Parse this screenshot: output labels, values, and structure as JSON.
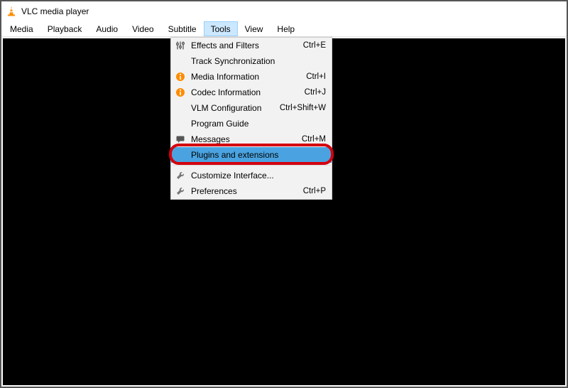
{
  "titlebar": {
    "title": "VLC media player"
  },
  "menubar": {
    "items": [
      {
        "label": "Media"
      },
      {
        "label": "Playback"
      },
      {
        "label": "Audio"
      },
      {
        "label": "Video"
      },
      {
        "label": "Subtitle"
      },
      {
        "label": "Tools"
      },
      {
        "label": "View"
      },
      {
        "label": "Help"
      }
    ],
    "open_index": 5
  },
  "tools_menu": {
    "items": [
      {
        "icon": "sliders-icon",
        "label": "Effects and Filters",
        "shortcut": "Ctrl+E"
      },
      {
        "icon": "",
        "label": "Track Synchronization",
        "shortcut": ""
      },
      {
        "icon": "info-orange-icon",
        "label": "Media Information",
        "shortcut": "Ctrl+I"
      },
      {
        "icon": "info-orange-icon",
        "label": "Codec Information",
        "shortcut": "Ctrl+J"
      },
      {
        "icon": "",
        "label": "VLM Configuration",
        "shortcut": "Ctrl+Shift+W"
      },
      {
        "icon": "",
        "label": "Program Guide",
        "shortcut": ""
      },
      {
        "icon": "message-icon",
        "label": "Messages",
        "shortcut": "Ctrl+M"
      },
      {
        "icon": "",
        "label": "Plugins and extensions",
        "shortcut": ""
      },
      {
        "icon": "wrench-icon",
        "label": "Customize Interface...",
        "shortcut": ""
      },
      {
        "icon": "wrench-icon",
        "label": "Preferences",
        "shortcut": "Ctrl+P"
      }
    ],
    "separators_after": [
      7
    ],
    "highlight_index": 7,
    "annotation_index": 7
  },
  "colors": {
    "highlight_bg": "#4aa3e0",
    "menu_hover_bg": "#cce8ff",
    "annotation_border": "#d4000e"
  }
}
